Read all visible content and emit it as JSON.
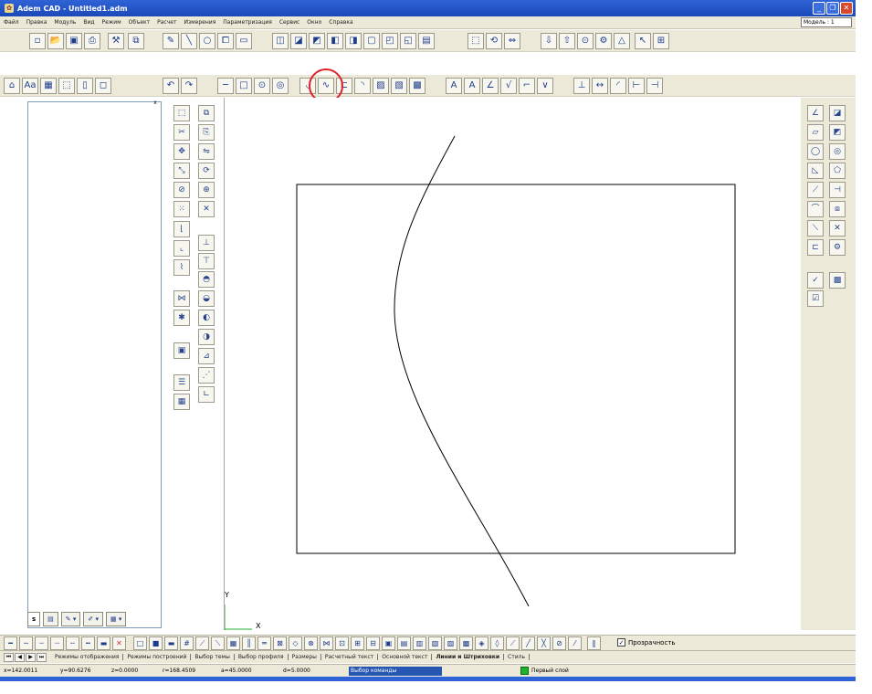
{
  "window": {
    "title": "Adem CAD - Untitled1.adm",
    "buttons": [
      "_",
      "❐",
      "✕"
    ]
  },
  "menu": {
    "items": [
      "Файл",
      "Правка",
      "Модуль",
      "Вид",
      "Режим",
      "Объект",
      "Расчет",
      "Измерения",
      "Параметризация",
      "Сервис",
      "Окно",
      "Справка"
    ],
    "model_selector": "Модель : 1"
  },
  "canvas": {
    "axis_y": "Y",
    "axis_x": "X"
  },
  "left_panel": {
    "close": "x",
    "tabs": [
      "s",
      "",
      "",
      ""
    ]
  },
  "bottom_toolbar": {
    "transparency_label": "Прозрачность",
    "transparency_checked": "✓"
  },
  "sheet_tabs": [
    "Режимы отображения",
    "Режимы построений",
    "Выбор темы",
    "Выбор профиля",
    "Размеры",
    "Расчетный текст",
    "Основной текст",
    "Линии и Штриховки",
    "Стиль"
  ],
  "sheet_tabs_active": "Линии и Штриховки",
  "status": {
    "x": "x=142.0011",
    "y": "y=90.6276",
    "z": "z=0.0000",
    "r": "r=168.4509",
    "a": "a=45.0000",
    "d": "d=5.0000",
    "command": "Выбор команды",
    "layer": "Первый слой"
  },
  "accent": {
    "title_blue": "#2f63d6",
    "highlight_red": "#e0202a",
    "layer_green": "#1fb22c"
  }
}
